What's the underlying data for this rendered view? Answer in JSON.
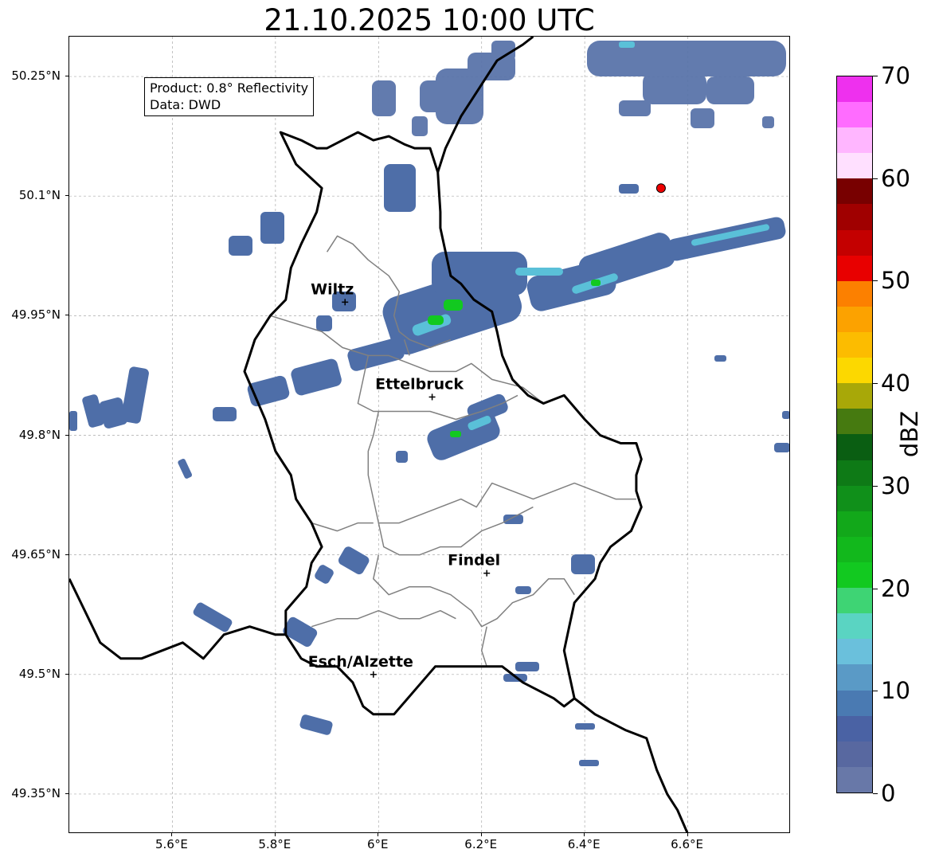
{
  "title": "21.10.2025 10:00 UTC",
  "info_box": {
    "product": "Product: 0.8° Reflectivity",
    "data": "Data: DWD"
  },
  "map": {
    "lon_range": [
      5.4,
      6.8
    ],
    "lat_range": [
      49.3,
      50.3
    ],
    "lat_labels": [
      {
        "value": 50.25,
        "text": "50.25°N"
      },
      {
        "value": 50.1,
        "text": "50.1°N"
      },
      {
        "value": 49.95,
        "text": "49.95°N"
      },
      {
        "value": 49.8,
        "text": "49.8°N"
      },
      {
        "value": 49.65,
        "text": "49.65°N"
      },
      {
        "value": 49.5,
        "text": "49.5°N"
      },
      {
        "value": 49.35,
        "text": "49.35°N"
      }
    ],
    "lon_labels": [
      {
        "value": 5.6,
        "text": "5.6°E"
      },
      {
        "value": 5.8,
        "text": "5.8°E"
      },
      {
        "value": 6.0,
        "text": "6°E"
      },
      {
        "value": 6.2,
        "text": "6.2°E"
      },
      {
        "value": 6.4,
        "text": "6.4°E"
      },
      {
        "value": 6.6,
        "text": "6.6°E"
      }
    ],
    "cities": [
      {
        "name": "Wiltz",
        "lon": 5.935,
        "lat": 49.967
      },
      {
        "name": "Ettelbruck",
        "lon": 6.104,
        "lat": 49.848
      },
      {
        "name": "Findel",
        "lon": 6.21,
        "lat": 49.627
      },
      {
        "name": "Esch/Alzette",
        "lon": 5.99,
        "lat": 49.5
      }
    ],
    "radar_site": {
      "lon": 6.548,
      "lat": 50.11,
      "color": "#ee0000"
    },
    "country_border": [
      [
        5.81,
        50.18
      ],
      [
        5.85,
        50.17
      ],
      [
        5.88,
        50.16
      ],
      [
        5.9,
        50.16
      ],
      [
        5.93,
        50.17
      ],
      [
        5.96,
        50.18
      ],
      [
        5.99,
        50.17
      ],
      [
        6.02,
        50.175
      ],
      [
        6.05,
        50.165
      ],
      [
        6.07,
        50.16
      ],
      [
        6.1,
        50.16
      ],
      [
        6.115,
        50.13
      ],
      [
        6.12,
        50.08
      ],
      [
        6.12,
        50.06
      ],
      [
        6.13,
        50.03
      ],
      [
        6.14,
        50.0
      ],
      [
        6.16,
        49.99
      ],
      [
        6.185,
        49.97
      ],
      [
        6.22,
        49.955
      ],
      [
        6.23,
        49.93
      ],
      [
        6.24,
        49.9
      ],
      [
        6.26,
        49.87
      ],
      [
        6.29,
        49.85
      ],
      [
        6.32,
        49.84
      ],
      [
        6.36,
        49.85
      ],
      [
        6.4,
        49.82
      ],
      [
        6.43,
        49.8
      ],
      [
        6.47,
        49.79
      ],
      [
        6.5,
        49.79
      ],
      [
        6.51,
        49.77
      ],
      [
        6.5,
        49.75
      ],
      [
        6.5,
        49.73
      ],
      [
        6.51,
        49.71
      ],
      [
        6.49,
        49.68
      ],
      [
        6.45,
        49.66
      ],
      [
        6.43,
        49.64
      ],
      [
        6.42,
        49.62
      ],
      [
        6.38,
        49.59
      ],
      [
        6.37,
        49.56
      ],
      [
        6.36,
        49.53
      ],
      [
        6.37,
        49.5
      ],
      [
        6.38,
        49.47
      ],
      [
        6.36,
        49.46
      ],
      [
        6.34,
        49.47
      ],
      [
        6.28,
        49.49
      ],
      [
        6.24,
        49.51
      ],
      [
        6.2,
        49.51
      ],
      [
        6.15,
        49.51
      ],
      [
        6.11,
        49.51
      ],
      [
        6.07,
        49.48
      ],
      [
        6.03,
        49.45
      ],
      [
        5.99,
        49.45
      ],
      [
        5.97,
        49.46
      ],
      [
        5.95,
        49.49
      ],
      [
        5.92,
        49.51
      ],
      [
        5.88,
        49.51
      ],
      [
        5.85,
        49.52
      ],
      [
        5.82,
        49.55
      ],
      [
        5.82,
        49.58
      ],
      [
        5.86,
        49.61
      ],
      [
        5.87,
        49.64
      ],
      [
        5.89,
        49.66
      ],
      [
        5.87,
        49.69
      ],
      [
        5.84,
        49.72
      ],
      [
        5.83,
        49.75
      ],
      [
        5.8,
        49.78
      ],
      [
        5.78,
        49.82
      ],
      [
        5.76,
        49.85
      ],
      [
        5.74,
        49.88
      ],
      [
        5.76,
        49.92
      ],
      [
        5.79,
        49.95
      ],
      [
        5.82,
        49.97
      ],
      [
        5.83,
        50.01
      ],
      [
        5.85,
        50.04
      ],
      [
        5.88,
        50.08
      ],
      [
        5.89,
        50.11
      ],
      [
        5.84,
        50.14
      ],
      [
        5.81,
        50.18
      ]
    ],
    "other_borders": [
      [
        [
          5.4,
          49.62
        ],
        [
          5.43,
          49.58
        ],
        [
          5.46,
          49.54
        ],
        [
          5.5,
          49.52
        ],
        [
          5.54,
          49.52
        ],
        [
          5.58,
          49.53
        ],
        [
          5.62,
          49.54
        ],
        [
          5.66,
          49.52
        ],
        [
          5.7,
          49.55
        ],
        [
          5.75,
          49.56
        ],
        [
          5.8,
          49.55
        ],
        [
          5.82,
          49.55
        ]
      ],
      [
        [
          6.38,
          49.47
        ],
        [
          6.42,
          49.45
        ],
        [
          6.45,
          49.44
        ],
        [
          6.48,
          49.43
        ],
        [
          6.52,
          49.42
        ],
        [
          6.54,
          49.38
        ],
        [
          6.56,
          49.35
        ],
        [
          6.58,
          49.33
        ],
        [
          6.6,
          49.3
        ]
      ],
      [
        [
          6.115,
          50.13
        ],
        [
          6.13,
          50.16
        ],
        [
          6.16,
          50.2
        ],
        [
          6.2,
          50.24
        ],
        [
          6.23,
          50.27
        ],
        [
          6.28,
          50.29
        ],
        [
          6.3,
          50.3
        ]
      ]
    ],
    "districts": [
      [
        [
          5.79,
          49.95
        ],
        [
          5.84,
          49.94
        ],
        [
          5.89,
          49.93
        ],
        [
          5.93,
          49.91
        ],
        [
          5.98,
          49.9
        ],
        [
          6.02,
          49.9
        ],
        [
          6.06,
          49.89
        ],
        [
          6.1,
          49.88
        ],
        [
          6.15,
          49.88
        ],
        [
          6.18,
          49.89
        ],
        [
          6.22,
          49.87
        ],
        [
          6.28,
          49.86
        ],
        [
          6.32,
          49.84
        ]
      ],
      [
        [
          5.98,
          49.9
        ],
        [
          5.97,
          49.87
        ],
        [
          5.96,
          49.84
        ],
        [
          5.99,
          49.83
        ],
        [
          6.05,
          49.83
        ],
        [
          6.1,
          49.83
        ],
        [
          6.15,
          49.82
        ],
        [
          6.2,
          49.83
        ],
        [
          6.24,
          49.84
        ],
        [
          6.27,
          49.85
        ]
      ],
      [
        [
          6.0,
          49.83
        ],
        [
          5.99,
          49.8
        ],
        [
          5.98,
          49.78
        ],
        [
          5.98,
          49.75
        ],
        [
          5.99,
          49.72
        ],
        [
          6.0,
          49.69
        ],
        [
          6.04,
          49.69
        ],
        [
          6.08,
          49.7
        ],
        [
          6.12,
          49.71
        ],
        [
          6.16,
          49.72
        ],
        [
          6.19,
          49.71
        ],
        [
          6.22,
          49.74
        ],
        [
          6.26,
          49.73
        ],
        [
          6.3,
          49.72
        ],
        [
          6.34,
          49.73
        ],
        [
          6.38,
          49.74
        ],
        [
          6.42,
          49.73
        ],
        [
          6.46,
          49.72
        ],
        [
          6.5,
          49.72
        ]
      ],
      [
        [
          5.87,
          49.69
        ],
        [
          5.92,
          49.68
        ],
        [
          5.96,
          49.69
        ],
        [
          5.99,
          49.69
        ]
      ],
      [
        [
          6.0,
          49.69
        ],
        [
          6.01,
          49.66
        ],
        [
          6.04,
          49.65
        ],
        [
          6.08,
          49.65
        ],
        [
          6.12,
          49.66
        ],
        [
          6.16,
          49.66
        ],
        [
          6.2,
          49.68
        ],
        [
          6.24,
          49.69
        ],
        [
          6.27,
          49.7
        ],
        [
          6.3,
          49.71
        ]
      ],
      [
        [
          6.0,
          49.65
        ],
        [
          5.99,
          49.62
        ],
        [
          6.02,
          49.6
        ],
        [
          6.06,
          49.61
        ],
        [
          6.1,
          49.61
        ],
        [
          6.14,
          49.6
        ],
        [
          6.18,
          49.58
        ],
        [
          6.2,
          49.56
        ],
        [
          6.23,
          49.57
        ],
        [
          6.26,
          49.59
        ],
        [
          6.3,
          49.6
        ],
        [
          6.33,
          49.62
        ],
        [
          6.36,
          49.62
        ],
        [
          6.38,
          49.6
        ]
      ],
      [
        [
          5.87,
          49.56
        ],
        [
          5.92,
          49.57
        ],
        [
          5.96,
          49.57
        ],
        [
          6.0,
          49.58
        ],
        [
          6.04,
          49.57
        ],
        [
          6.08,
          49.57
        ],
        [
          6.12,
          49.58
        ],
        [
          6.15,
          49.57
        ]
      ],
      [
        [
          6.21,
          49.56
        ],
        [
          6.2,
          49.53
        ],
        [
          6.21,
          49.51
        ]
      ],
      [
        [
          5.9,
          50.03
        ],
        [
          5.92,
          50.05
        ],
        [
          5.95,
          50.04
        ],
        [
          5.98,
          50.02
        ],
        [
          6.02,
          50.0
        ],
        [
          6.04,
          49.98
        ],
        [
          6.03,
          49.95
        ],
        [
          6.04,
          49.93
        ],
        [
          6.06,
          49.92
        ],
        [
          6.1,
          49.91
        ],
        [
          6.14,
          49.92
        ]
      ],
      [
        [
          6.05,
          49.92
        ],
        [
          6.06,
          49.9
        ]
      ]
    ]
  },
  "colorbar": {
    "label": "dBZ",
    "ticks": [
      {
        "value": 0,
        "text": "0"
      },
      {
        "value": 10,
        "text": "10"
      },
      {
        "value": 20,
        "text": "20"
      },
      {
        "value": 30,
        "text": "30"
      },
      {
        "value": 40,
        "text": "40"
      },
      {
        "value": 50,
        "text": "50"
      },
      {
        "value": 60,
        "text": "60"
      },
      {
        "value": 70,
        "text": "70"
      }
    ],
    "range": [
      0,
      70
    ],
    "colors": [
      "#6878a8",
      "#5868a0",
      "#4a62a4",
      "#4a7ab2",
      "#5a9ac6",
      "#6ac0dc",
      "#5ad4c2",
      "#3ed474",
      "#12c920",
      "#12b81c",
      "#12a81a",
      "#10901a",
      "#0e7a16",
      "#0a5e12",
      "#467a10",
      "#a8a808",
      "#fcd800",
      "#fcbc00",
      "#fca200",
      "#fc8000",
      "#e80000",
      "#c40000",
      "#a00000",
      "#780000",
      "#ffe0ff",
      "#ffb6ff",
      "#ff6cff",
      "#ee30ee"
    ]
  }
}
